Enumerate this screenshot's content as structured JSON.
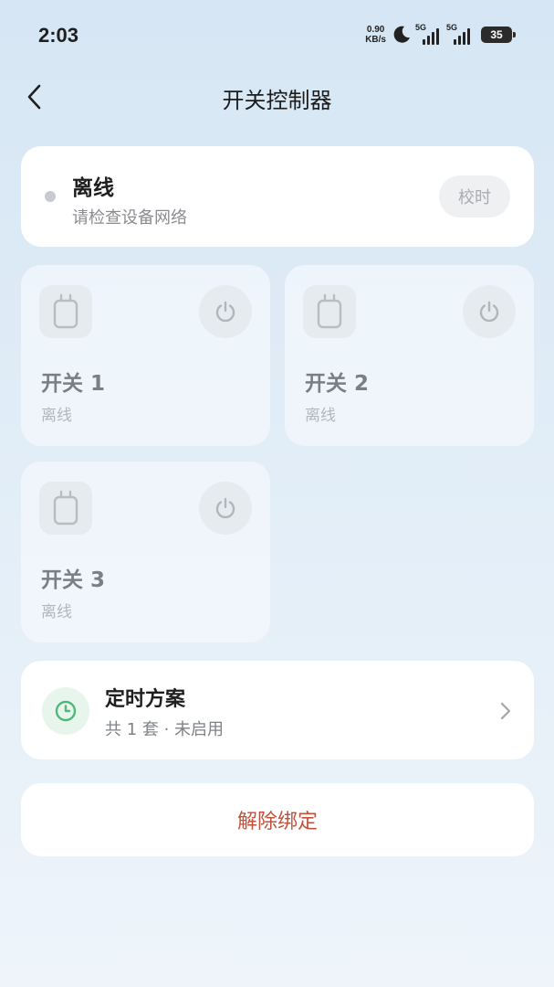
{
  "status_bar": {
    "time": "2:03",
    "net_speed_value": "0.90",
    "net_speed_unit": "KB/s",
    "signal1_label": "5G",
    "signal2_label": "5G",
    "battery_level": "35"
  },
  "header": {
    "title": "开关控制器"
  },
  "device_status": {
    "title": "离线",
    "subtitle": "请检查设备网络",
    "sync_button": "校时"
  },
  "switches": [
    {
      "name": "开关 1",
      "state": "离线"
    },
    {
      "name": "开关 2",
      "state": "离线"
    },
    {
      "name": "开关 3",
      "state": "离线"
    }
  ],
  "timer": {
    "title": "定时方案",
    "subtitle": "共 1 套 · 未启用"
  },
  "unbind": {
    "label": "解除绑定"
  },
  "colors": {
    "accent_red": "#c2513b",
    "timer_green": "#4fb87a",
    "offline_dot": "#c8cad1"
  }
}
